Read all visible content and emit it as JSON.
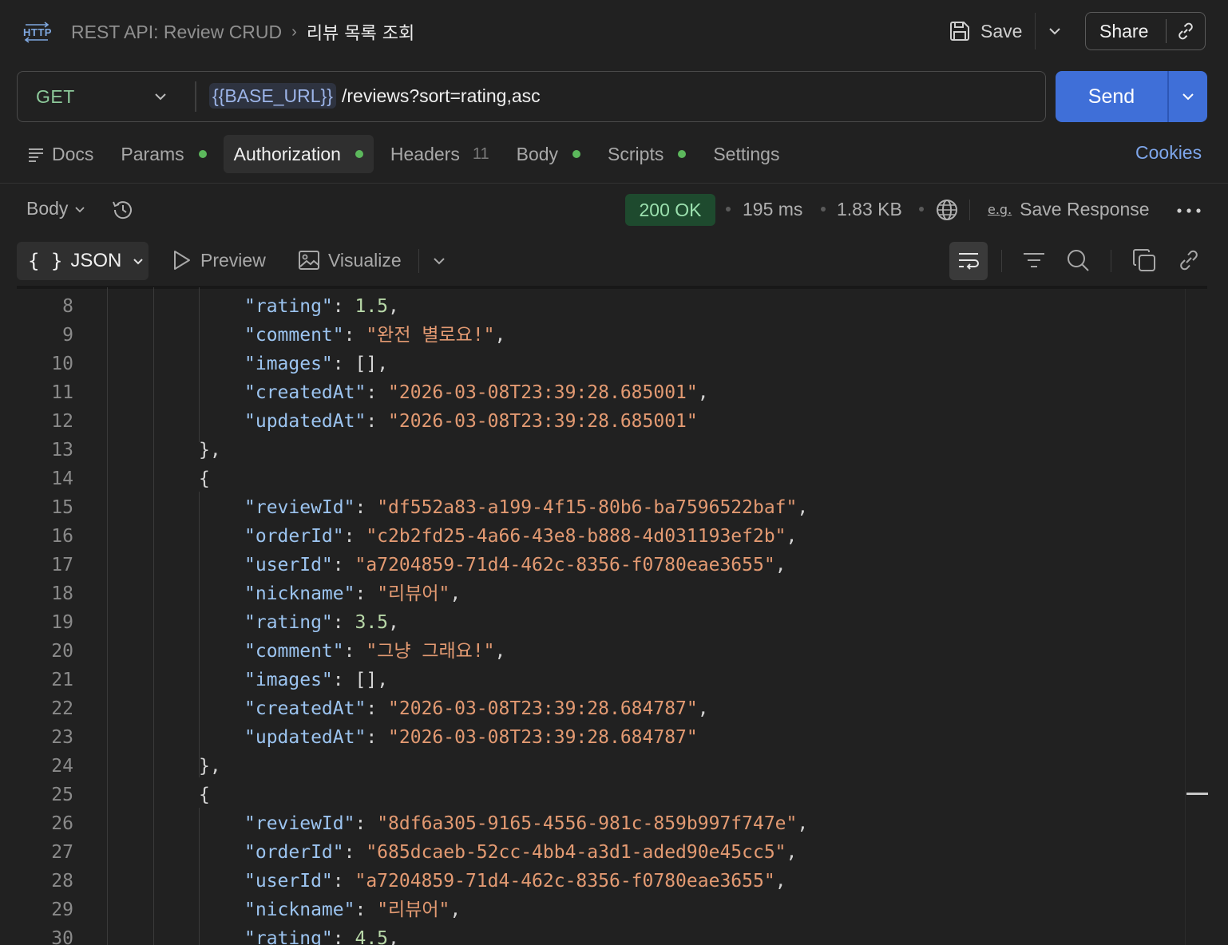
{
  "header": {
    "collection": "REST API: Review CRUD",
    "request_name": "리뷰 목록 조회",
    "save_label": "Save",
    "share_label": "Share"
  },
  "request": {
    "method": "GET",
    "url_variable": "{{BASE_URL}}",
    "url_path": "/reviews?sort=rating,asc",
    "send_label": "Send"
  },
  "tabs": [
    {
      "label": "Docs"
    },
    {
      "label": "Params",
      "dot": true
    },
    {
      "label": "Authorization",
      "dot": true,
      "active": true
    },
    {
      "label": "Headers",
      "count": "11"
    },
    {
      "label": "Body",
      "dot": true
    },
    {
      "label": "Scripts",
      "dot": true
    },
    {
      "label": "Settings"
    }
  ],
  "cookies_label": "Cookies",
  "response": {
    "view_label": "Body",
    "status": "200 OK",
    "time": "195 ms",
    "size": "1.83 KB",
    "save_response_label": "Save Response",
    "eg_label": "e.g.",
    "format_label": "JSON",
    "preview_label": "Preview",
    "visualize_label": "Visualize"
  },
  "colors": {
    "send": "#3f6fd8",
    "status_bg": "#1e4a2e",
    "status_text": "#9be0ae",
    "method": "#8cc99a",
    "json_key": "#9cc4f0",
    "json_string": "#e39a72",
    "json_number": "#b8d8a8"
  },
  "code_lines": [
    {
      "n": "8",
      "indent": 2,
      "k": "rating",
      "v": "1.5",
      "t": "num",
      "comma": true
    },
    {
      "n": "9",
      "indent": 2,
      "k": "comment",
      "v": "\"완전 별로요!\"",
      "t": "str",
      "comma": true
    },
    {
      "n": "10",
      "indent": 2,
      "k": "images",
      "v": "[]",
      "t": "plain",
      "comma": true
    },
    {
      "n": "11",
      "indent": 2,
      "k": "createdAt",
      "v": "\"2026-03-08T23:39:28.685001\"",
      "t": "str",
      "comma": true
    },
    {
      "n": "12",
      "indent": 2,
      "k": "updatedAt",
      "v": "\"2026-03-08T23:39:28.685001\"",
      "t": "str",
      "comma": false
    },
    {
      "n": "13",
      "indent": 1,
      "raw": "},"
    },
    {
      "n": "14",
      "indent": 1,
      "raw": "{"
    },
    {
      "n": "15",
      "indent": 2,
      "k": "reviewId",
      "v": "\"df552a83-a199-4f15-80b6-ba7596522baf\"",
      "t": "str",
      "comma": true
    },
    {
      "n": "16",
      "indent": 2,
      "k": "orderId",
      "v": "\"c2b2fd25-4a66-43e8-b888-4d031193ef2b\"",
      "t": "str",
      "comma": true
    },
    {
      "n": "17",
      "indent": 2,
      "k": "userId",
      "v": "\"a7204859-71d4-462c-8356-f0780eae3655\"",
      "t": "str",
      "comma": true
    },
    {
      "n": "18",
      "indent": 2,
      "k": "nickname",
      "v": "\"리뷰어\"",
      "t": "str",
      "comma": true
    },
    {
      "n": "19",
      "indent": 2,
      "k": "rating",
      "v": "3.5",
      "t": "num",
      "comma": true
    },
    {
      "n": "20",
      "indent": 2,
      "k": "comment",
      "v": "\"그냥 그래요!\"",
      "t": "str",
      "comma": true
    },
    {
      "n": "21",
      "indent": 2,
      "k": "images",
      "v": "[]",
      "t": "plain",
      "comma": true
    },
    {
      "n": "22",
      "indent": 2,
      "k": "createdAt",
      "v": "\"2026-03-08T23:39:28.684787\"",
      "t": "str",
      "comma": true
    },
    {
      "n": "23",
      "indent": 2,
      "k": "updatedAt",
      "v": "\"2026-03-08T23:39:28.684787\"",
      "t": "str",
      "comma": false
    },
    {
      "n": "24",
      "indent": 1,
      "raw": "},"
    },
    {
      "n": "25",
      "indent": 1,
      "raw": "{"
    },
    {
      "n": "26",
      "indent": 2,
      "k": "reviewId",
      "v": "\"8df6a305-9165-4556-981c-859b997f747e\"",
      "t": "str",
      "comma": true
    },
    {
      "n": "27",
      "indent": 2,
      "k": "orderId",
      "v": "\"685dcaeb-52cc-4bb4-a3d1-aded90e45cc5\"",
      "t": "str",
      "comma": true
    },
    {
      "n": "28",
      "indent": 2,
      "k": "userId",
      "v": "\"a7204859-71d4-462c-8356-f0780eae3655\"",
      "t": "str",
      "comma": true
    },
    {
      "n": "29",
      "indent": 2,
      "k": "nickname",
      "v": "\"리뷰어\"",
      "t": "str",
      "comma": true
    },
    {
      "n": "30",
      "indent": 2,
      "k": "rating",
      "v": "4.5",
      "t": "num",
      "comma": true
    }
  ]
}
